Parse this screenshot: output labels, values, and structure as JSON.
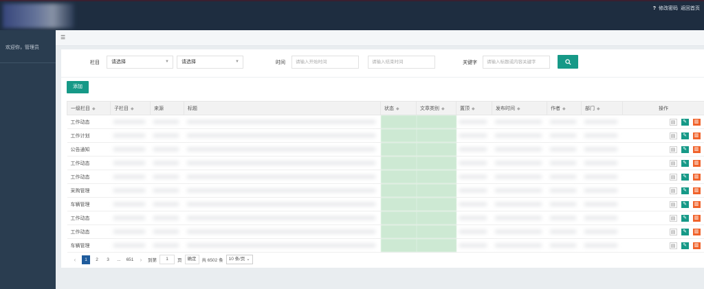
{
  "header": {
    "help_glyph": "?",
    "change_password": "修改密码",
    "back_home": "返回首页"
  },
  "sidebar": {
    "welcome": "欢迎你，管理员"
  },
  "filters": {
    "column_label": "栏目",
    "column_select_1": "请选择",
    "column_select_2": "请选择",
    "time_label": "时间",
    "start_placeholder": "请输入开始时间",
    "end_placeholder": "请输入结束时间",
    "keyword_label": "关键字",
    "keyword_placeholder": "请输入标题或内容关键字"
  },
  "actions": {
    "add_label": "添加"
  },
  "table": {
    "headers": [
      "一级栏目",
      "子栏目",
      "来源",
      "标题",
      "状态",
      "文章类别",
      "置顶",
      "发布时间",
      "作者",
      "部门",
      "操作"
    ],
    "rows": [
      {
        "level1": "工作动态"
      },
      {
        "level1": "工作计划"
      },
      {
        "level1": "公告通知"
      },
      {
        "level1": "工作动态"
      },
      {
        "level1": "工作动态"
      },
      {
        "level1": "采购管理"
      },
      {
        "level1": "车辆管理"
      },
      {
        "level1": "工作动态"
      },
      {
        "level1": "工作动态"
      },
      {
        "level1": "车辆管理"
      }
    ]
  },
  "pagination": {
    "prev": "‹",
    "pages": [
      "1",
      "2",
      "3",
      "...",
      "651"
    ],
    "next": "›",
    "goto_label": "到第",
    "goto_value": "1",
    "page_unit": "页",
    "confirm": "确定",
    "total": "共 6502 条",
    "page_size": "10 条/页"
  },
  "colors": {
    "header_bg": "#1e2d40",
    "sidebar_bg": "#2a3d50",
    "primary": "#169987",
    "danger": "#f0622a",
    "active_page": "#1e5b9c"
  }
}
